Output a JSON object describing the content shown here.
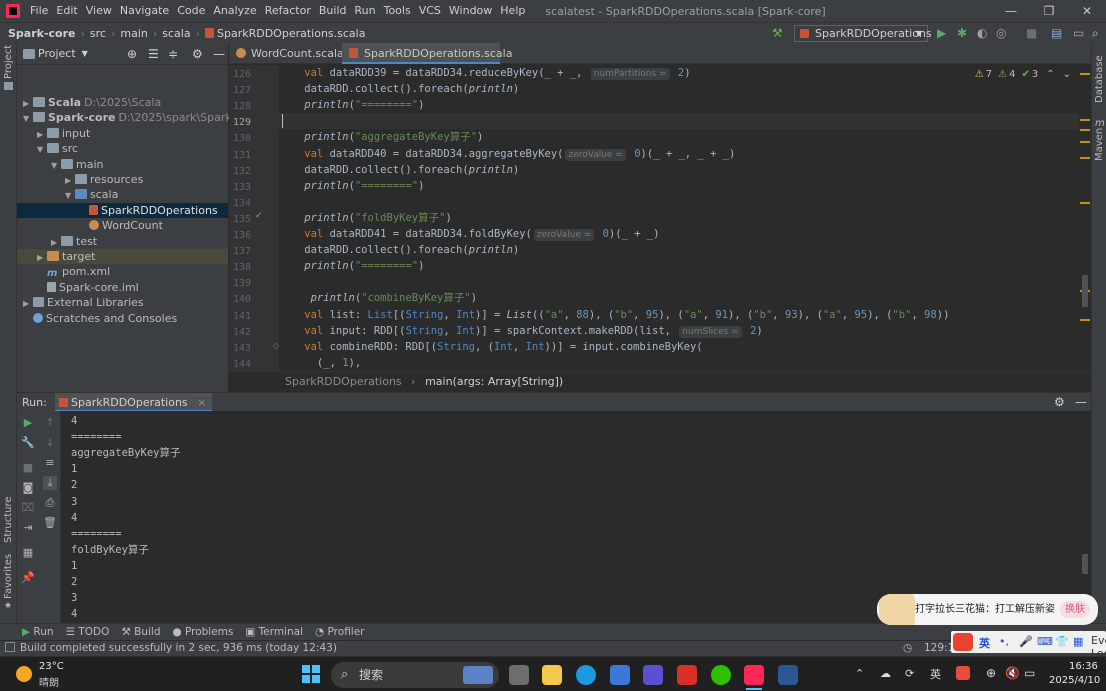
{
  "title_bar": {
    "menus": [
      "File",
      "Edit",
      "View",
      "Navigate",
      "Code",
      "Analyze",
      "Refactor",
      "Build",
      "Run",
      "Tools",
      "VCS",
      "Window",
      "Help"
    ],
    "window_title": "scalatest - SparkRDDOperations.scala [Spark-core]",
    "controls": [
      "—",
      "❐",
      "✕"
    ]
  },
  "nav_bar": {
    "breadcrumbs": [
      "Spark-core",
      "src",
      "main",
      "scala",
      "SparkRDDOperations.scala"
    ],
    "run_config": "SparkRDDOperations"
  },
  "project_panel": {
    "title": "Project",
    "tree": [
      {
        "label": "Scala",
        "path": "D:\\2025\\Scala",
        "depth": 0,
        "arrow": "▶",
        "icon": "folder"
      },
      {
        "label": "Spark-core",
        "path": "D:\\2025\\spark\\Spark-core",
        "depth": 0,
        "arrow": "▼",
        "icon": "folder"
      },
      {
        "label": "input",
        "path": "",
        "depth": 1,
        "arrow": "▶",
        "icon": "folder"
      },
      {
        "label": "src",
        "path": "",
        "depth": 1,
        "arrow": "▼",
        "icon": "folder"
      },
      {
        "label": "main",
        "path": "",
        "depth": 2,
        "arrow": "▼",
        "icon": "folder"
      },
      {
        "label": "resources",
        "path": "",
        "depth": 3,
        "arrow": "▶",
        "icon": "folder"
      },
      {
        "label": "scala",
        "path": "",
        "depth": 3,
        "arrow": "▼",
        "icon": "folder-blue"
      },
      {
        "label": "SparkRDDOperations",
        "path": "",
        "depth": 4,
        "arrow": "",
        "icon": "scala-file"
      },
      {
        "label": "WordCount",
        "path": "",
        "depth": 4,
        "arrow": "",
        "icon": "object"
      },
      {
        "label": "test",
        "path": "",
        "depth": 2,
        "arrow": "▶",
        "icon": "folder"
      },
      {
        "label": "target",
        "path": "",
        "depth": 1,
        "arrow": "▶",
        "icon": "folder-orange"
      },
      {
        "label": "pom.xml",
        "path": "",
        "depth": 1,
        "arrow": "",
        "icon": "maven"
      },
      {
        "label": "Spark-core.iml",
        "path": "",
        "depth": 1,
        "arrow": "",
        "icon": "iml"
      },
      {
        "label": "External Libraries",
        "path": "",
        "depth": 0,
        "arrow": "▶",
        "icon": "library"
      },
      {
        "label": "Scratches and Consoles",
        "path": "",
        "depth": 0,
        "arrow": "",
        "icon": "scratch"
      }
    ]
  },
  "editor": {
    "tabs": [
      {
        "label": "WordCount.scala",
        "active": false
      },
      {
        "label": "SparkRDDOperations.scala",
        "active": true
      }
    ],
    "inspections": {
      "warnings": "7",
      "weak_warnings": "4",
      "ok": "3"
    },
    "line_numbers": [
      "126",
      "127",
      "128",
      "129",
      "130",
      "131",
      "132",
      "133",
      "134",
      "135",
      "136",
      "137",
      "138",
      "139",
      "140",
      "141",
      "142",
      "143",
      "144"
    ],
    "current_line": "129",
    "lines": [
      [
        {
          "t": "    val ",
          "c": "kw"
        },
        {
          "t": "dataRDD39 = dataRDD34.reduceByKey(_ + _, "
        },
        {
          "t": "numPartitions =",
          "c": "hint"
        },
        {
          "t": " 2",
          "c": "num"
        },
        {
          "t": ")"
        }
      ],
      [
        {
          "t": "    dataRDD.collect().foreach("
        },
        {
          "t": "println",
          "c": "fn"
        },
        {
          "t": ")"
        }
      ],
      [
        {
          "t": "    "
        },
        {
          "t": "println",
          "c": "fn"
        },
        {
          "t": "("
        },
        {
          "t": "\"========\"",
          "c": "str"
        },
        {
          "t": ")"
        }
      ],
      [
        {
          "t": ""
        }
      ],
      [
        {
          "t": "    "
        },
        {
          "t": "println",
          "c": "fn"
        },
        {
          "t": "("
        },
        {
          "t": "\"aggregateByKey算子\"",
          "c": "str"
        },
        {
          "t": ")"
        }
      ],
      [
        {
          "t": "    val ",
          "c": "kw"
        },
        {
          "t": "dataRDD40 = dataRDD34.aggregateByKey("
        },
        {
          "t": "zeroValue =",
          "c": "hint"
        },
        {
          "t": " 0",
          "c": "num"
        },
        {
          "t": ")(_ + _, _ + _)"
        }
      ],
      [
        {
          "t": "    dataRDD.collect().foreach("
        },
        {
          "t": "println",
          "c": "fn"
        },
        {
          "t": ")"
        }
      ],
      [
        {
          "t": "    "
        },
        {
          "t": "println",
          "c": "fn"
        },
        {
          "t": "("
        },
        {
          "t": "\"========\"",
          "c": "str"
        },
        {
          "t": ")"
        }
      ],
      [
        {
          "t": ""
        }
      ],
      [
        {
          "t": "    "
        },
        {
          "t": "println",
          "c": "fn"
        },
        {
          "t": "("
        },
        {
          "t": "\"foldByKey算子\"",
          "c": "str"
        },
        {
          "t": ")"
        }
      ],
      [
        {
          "t": "    val ",
          "c": "kw"
        },
        {
          "t": "dataRDD41 = dataRDD34.foldByKey("
        },
        {
          "t": "zeroValue =",
          "c": "hint"
        },
        {
          "t": " 0",
          "c": "num"
        },
        {
          "t": ")(_ + _)"
        }
      ],
      [
        {
          "t": "    dataRDD.collect().foreach("
        },
        {
          "t": "println",
          "c": "fn"
        },
        {
          "t": ")"
        }
      ],
      [
        {
          "t": "    "
        },
        {
          "t": "println",
          "c": "fn"
        },
        {
          "t": "("
        },
        {
          "t": "\"========\"",
          "c": "str"
        },
        {
          "t": ")"
        }
      ],
      [
        {
          "t": ""
        }
      ],
      [
        {
          "t": "     "
        },
        {
          "t": "println",
          "c": "fn"
        },
        {
          "t": "("
        },
        {
          "t": "\"combineByKey算子\"",
          "c": "str"
        },
        {
          "t": ")"
        }
      ],
      [
        {
          "t": "    val ",
          "c": "kw"
        },
        {
          "t": "list: "
        },
        {
          "t": "List",
          "c": "ty"
        },
        {
          "t": "[("
        },
        {
          "t": "String",
          "c": "ty"
        },
        {
          "t": ", "
        },
        {
          "t": "Int",
          "c": "ty"
        },
        {
          "t": ")] = "
        },
        {
          "t": "List",
          "c": "fn"
        },
        {
          "t": "(("
        },
        {
          "t": "\"a\"",
          "c": "str"
        },
        {
          "t": ", "
        },
        {
          "t": "88",
          "c": "num"
        },
        {
          "t": "), ("
        },
        {
          "t": "\"b\"",
          "c": "str"
        },
        {
          "t": ", "
        },
        {
          "t": "95",
          "c": "num"
        },
        {
          "t": "), ("
        },
        {
          "t": "\"a\"",
          "c": "str"
        },
        {
          "t": ", "
        },
        {
          "t": "91",
          "c": "num"
        },
        {
          "t": "), ("
        },
        {
          "t": "\"b\"",
          "c": "str"
        },
        {
          "t": ", "
        },
        {
          "t": "93",
          "c": "num"
        },
        {
          "t": "), ("
        },
        {
          "t": "\"a\"",
          "c": "str"
        },
        {
          "t": ", "
        },
        {
          "t": "95",
          "c": "num"
        },
        {
          "t": "), ("
        },
        {
          "t": "\"b\"",
          "c": "str"
        },
        {
          "t": ", "
        },
        {
          "t": "98",
          "c": "num"
        },
        {
          "t": "))"
        }
      ],
      [
        {
          "t": "    val ",
          "c": "kw"
        },
        {
          "t": "input: RDD[("
        },
        {
          "t": "String",
          "c": "ty"
        },
        {
          "t": ", "
        },
        {
          "t": "Int",
          "c": "ty"
        },
        {
          "t": ")] = sparkContext.makeRDD(list, "
        },
        {
          "t": "numSlices =",
          "c": "hint"
        },
        {
          "t": " 2",
          "c": "num"
        },
        {
          "t": ")"
        }
      ],
      [
        {
          "t": "    val ",
          "c": "kw"
        },
        {
          "t": "combineRDD: RDD[("
        },
        {
          "t": "String",
          "c": "ty"
        },
        {
          "t": ", ("
        },
        {
          "t": "Int",
          "c": "ty"
        },
        {
          "t": ", "
        },
        {
          "t": "Int",
          "c": "ty"
        },
        {
          "t": "))] = input.combineByKey("
        }
      ],
      [
        {
          "t": "      (_, "
        },
        {
          "t": "1",
          "c": "num"
        },
        {
          "t": "),"
        }
      ]
    ],
    "breadcrumb": [
      "SparkRDDOperations",
      "main(args: Array[String])"
    ]
  },
  "run_panel": {
    "label": "Run:",
    "tab": "SparkRDDOperations",
    "output": [
      "4",
      "========",
      "aggregateByKey算子",
      "1",
      "2",
      "3",
      "4",
      "========",
      "foldByKey算子",
      "1",
      "2",
      "3",
      "4"
    ]
  },
  "tool_tabs": [
    "Run",
    "TODO",
    "Build",
    "Problems",
    "Terminal",
    "Profiler"
  ],
  "status_bar": {
    "message": "Build completed successfully in 2 sec, 936 ms (today 12:43)",
    "position": "129:1",
    "event_log": "Event Log"
  },
  "side_stripes": {
    "left": [
      "Project",
      "Structure",
      "Favorites"
    ],
    "right": [
      "Database",
      "Maven"
    ]
  },
  "taskbar": {
    "weather_temp": "23°C",
    "weather_desc": "晴朗",
    "search_placeholder": "搜索",
    "ime_lang": "英",
    "time": "16:36",
    "date": "2025/4/10"
  },
  "ime_popup": {
    "text": "打字拉长三花猫：打工解压新姿",
    "button": "换肤",
    "bar_lang": "英"
  },
  "colors": {
    "bg_editor": "#2b2b2b",
    "bg_panel": "#3c3f41",
    "selection": "#0d293e",
    "accent": "#4a88c7",
    "keyword": "#cc7832",
    "string": "#6a8759",
    "number": "#6897bb"
  }
}
